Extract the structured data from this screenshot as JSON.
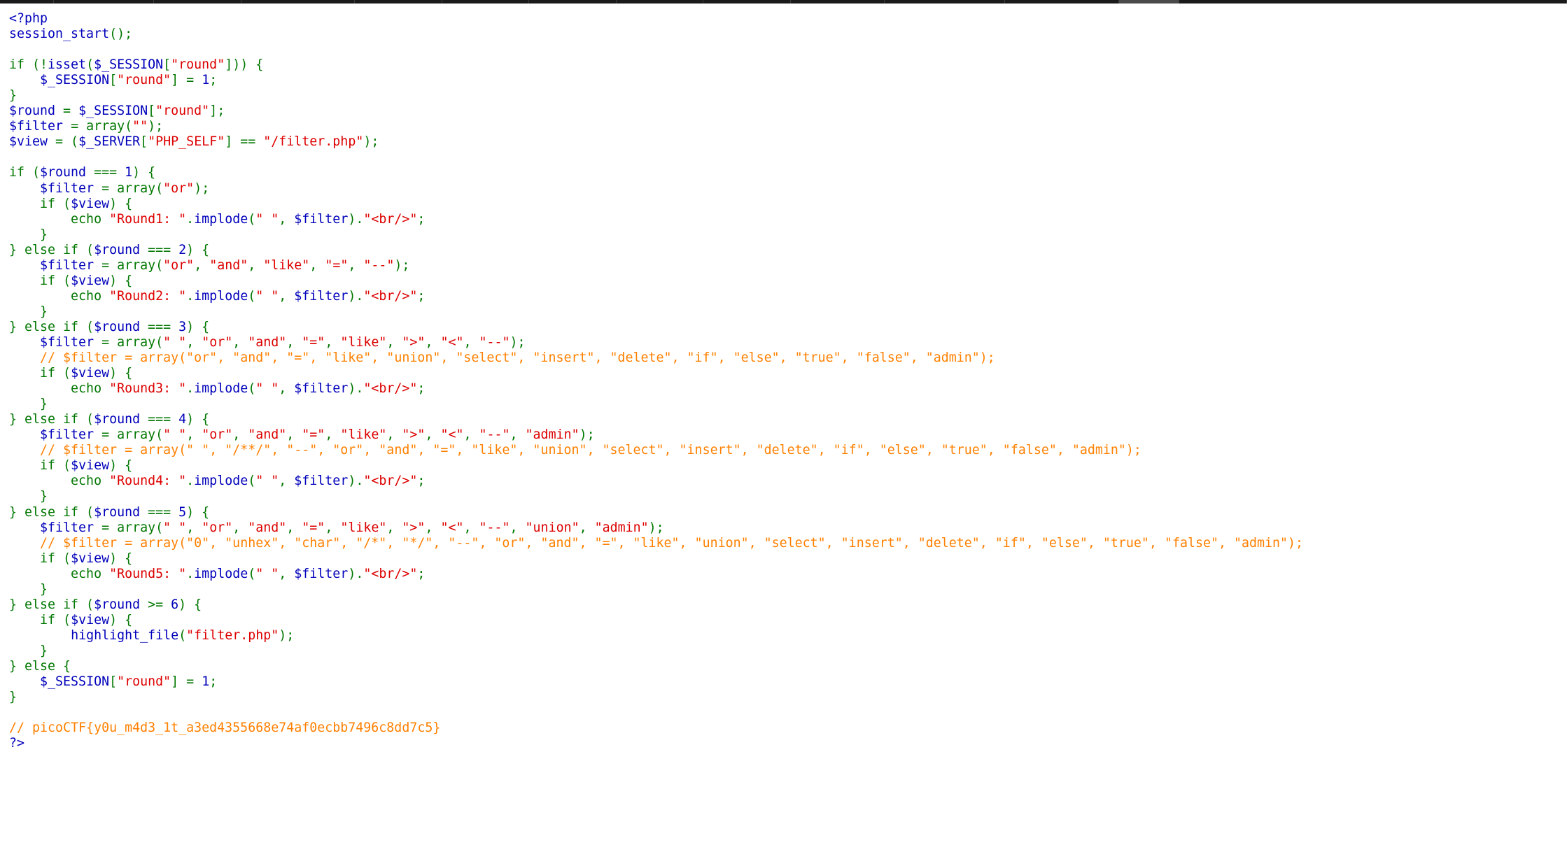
{
  "source": {
    "colors": {
      "default": "#0000BB",
      "keyword": "#007700",
      "string": "#DD0000",
      "comment": "#FF8000",
      "background": "#FFFFFF"
    },
    "lines": [
      [
        [
          "v",
          "<?php"
        ]
      ],
      [
        [
          "v",
          "session_start"
        ],
        [
          "k",
          "();"
        ]
      ],
      [],
      [
        [
          "k",
          "if (!"
        ],
        [
          "v",
          "isset"
        ],
        [
          "k",
          "("
        ],
        [
          "v",
          "$_SESSION"
        ],
        [
          "k",
          "["
        ],
        [
          "s",
          "\"round\""
        ],
        [
          "k",
          "])) {"
        ]
      ],
      [
        [
          "k",
          "    "
        ],
        [
          "v",
          "$_SESSION"
        ],
        [
          "k",
          "["
        ],
        [
          "s",
          "\"round\""
        ],
        [
          "k",
          "] = "
        ],
        [
          "v",
          "1"
        ],
        [
          "k",
          ";"
        ]
      ],
      [
        [
          "k",
          "}"
        ]
      ],
      [
        [
          "v",
          "$round "
        ],
        [
          "k",
          "= "
        ],
        [
          "v",
          "$_SESSION"
        ],
        [
          "k",
          "["
        ],
        [
          "s",
          "\"round\""
        ],
        [
          "k",
          "];"
        ]
      ],
      [
        [
          "v",
          "$filter "
        ],
        [
          "k",
          "= array("
        ],
        [
          "s",
          "\"\""
        ],
        [
          "k",
          ");"
        ]
      ],
      [
        [
          "v",
          "$view "
        ],
        [
          "k",
          "= ("
        ],
        [
          "v",
          "$_SERVER"
        ],
        [
          "k",
          "["
        ],
        [
          "s",
          "\"PHP_SELF\""
        ],
        [
          "k",
          "] == "
        ],
        [
          "s",
          "\"/filter.php\""
        ],
        [
          "k",
          ");"
        ]
      ],
      [],
      [
        [
          "k",
          "if ("
        ],
        [
          "v",
          "$round "
        ],
        [
          "k",
          "=== "
        ],
        [
          "v",
          "1"
        ],
        [
          "k",
          ") {"
        ]
      ],
      [
        [
          "k",
          "    "
        ],
        [
          "v",
          "$filter "
        ],
        [
          "k",
          "= array("
        ],
        [
          "s",
          "\"or\""
        ],
        [
          "k",
          ");"
        ]
      ],
      [
        [
          "k",
          "    if ("
        ],
        [
          "v",
          "$view"
        ],
        [
          "k",
          ") {"
        ]
      ],
      [
        [
          "k",
          "        echo "
        ],
        [
          "s",
          "\"Round1: \""
        ],
        [
          "k",
          "."
        ],
        [
          "v",
          "implode"
        ],
        [
          "k",
          "("
        ],
        [
          "s",
          "\" \""
        ],
        [
          "k",
          ", "
        ],
        [
          "v",
          "$filter"
        ],
        [
          "k",
          ")."
        ],
        [
          "s",
          "\"<br/>\""
        ],
        [
          "k",
          ";"
        ]
      ],
      [
        [
          "k",
          "    }"
        ]
      ],
      [
        [
          "k",
          "} else if ("
        ],
        [
          "v",
          "$round "
        ],
        [
          "k",
          "=== "
        ],
        [
          "v",
          "2"
        ],
        [
          "k",
          ") {"
        ]
      ],
      [
        [
          "k",
          "    "
        ],
        [
          "v",
          "$filter "
        ],
        [
          "k",
          "= array("
        ],
        [
          "s",
          "\"or\""
        ],
        [
          "k",
          ", "
        ],
        [
          "s",
          "\"and\""
        ],
        [
          "k",
          ", "
        ],
        [
          "s",
          "\"like\""
        ],
        [
          "k",
          ", "
        ],
        [
          "s",
          "\"=\""
        ],
        [
          "k",
          ", "
        ],
        [
          "s",
          "\"--\""
        ],
        [
          "k",
          ");"
        ]
      ],
      [
        [
          "k",
          "    if ("
        ],
        [
          "v",
          "$view"
        ],
        [
          "k",
          ") {"
        ]
      ],
      [
        [
          "k",
          "        echo "
        ],
        [
          "s",
          "\"Round2: \""
        ],
        [
          "k",
          "."
        ],
        [
          "v",
          "implode"
        ],
        [
          "k",
          "("
        ],
        [
          "s",
          "\" \""
        ],
        [
          "k",
          ", "
        ],
        [
          "v",
          "$filter"
        ],
        [
          "k",
          ")."
        ],
        [
          "s",
          "\"<br/>\""
        ],
        [
          "k",
          ";"
        ]
      ],
      [
        [
          "k",
          "    }"
        ]
      ],
      [
        [
          "k",
          "} else if ("
        ],
        [
          "v",
          "$round "
        ],
        [
          "k",
          "=== "
        ],
        [
          "v",
          "3"
        ],
        [
          "k",
          ") {"
        ]
      ],
      [
        [
          "k",
          "    "
        ],
        [
          "v",
          "$filter "
        ],
        [
          "k",
          "= array("
        ],
        [
          "s",
          "\" \""
        ],
        [
          "k",
          ", "
        ],
        [
          "s",
          "\"or\""
        ],
        [
          "k",
          ", "
        ],
        [
          "s",
          "\"and\""
        ],
        [
          "k",
          ", "
        ],
        [
          "s",
          "\"=\""
        ],
        [
          "k",
          ", "
        ],
        [
          "s",
          "\"like\""
        ],
        [
          "k",
          ", "
        ],
        [
          "s",
          "\">\""
        ],
        [
          "k",
          ", "
        ],
        [
          "s",
          "\"<\""
        ],
        [
          "k",
          ", "
        ],
        [
          "s",
          "\"--\""
        ],
        [
          "k",
          ");"
        ]
      ],
      [
        [
          "k",
          "    "
        ],
        [
          "c",
          "// $filter = array(\"or\", \"and\", \"=\", \"like\", \"union\", \"select\", \"insert\", \"delete\", \"if\", \"else\", \"true\", \"false\", \"admin\");"
        ]
      ],
      [
        [
          "k",
          "    if ("
        ],
        [
          "v",
          "$view"
        ],
        [
          "k",
          ") {"
        ]
      ],
      [
        [
          "k",
          "        echo "
        ],
        [
          "s",
          "\"Round3: \""
        ],
        [
          "k",
          "."
        ],
        [
          "v",
          "implode"
        ],
        [
          "k",
          "("
        ],
        [
          "s",
          "\" \""
        ],
        [
          "k",
          ", "
        ],
        [
          "v",
          "$filter"
        ],
        [
          "k",
          ")."
        ],
        [
          "s",
          "\"<br/>\""
        ],
        [
          "k",
          ";"
        ]
      ],
      [
        [
          "k",
          "    }"
        ]
      ],
      [
        [
          "k",
          "} else if ("
        ],
        [
          "v",
          "$round "
        ],
        [
          "k",
          "=== "
        ],
        [
          "v",
          "4"
        ],
        [
          "k",
          ") {"
        ]
      ],
      [
        [
          "k",
          "    "
        ],
        [
          "v",
          "$filter "
        ],
        [
          "k",
          "= array("
        ],
        [
          "s",
          "\" \""
        ],
        [
          "k",
          ", "
        ],
        [
          "s",
          "\"or\""
        ],
        [
          "k",
          ", "
        ],
        [
          "s",
          "\"and\""
        ],
        [
          "k",
          ", "
        ],
        [
          "s",
          "\"=\""
        ],
        [
          "k",
          ", "
        ],
        [
          "s",
          "\"like\""
        ],
        [
          "k",
          ", "
        ],
        [
          "s",
          "\">\""
        ],
        [
          "k",
          ", "
        ],
        [
          "s",
          "\"<\""
        ],
        [
          "k",
          ", "
        ],
        [
          "s",
          "\"--\""
        ],
        [
          "k",
          ", "
        ],
        [
          "s",
          "\"admin\""
        ],
        [
          "k",
          ");"
        ]
      ],
      [
        [
          "k",
          "    "
        ],
        [
          "c",
          "// $filter = array(\" \", \"/**/\", \"--\", \"or\", \"and\", \"=\", \"like\", \"union\", \"select\", \"insert\", \"delete\", \"if\", \"else\", \"true\", \"false\", \"admin\");"
        ]
      ],
      [
        [
          "k",
          "    if ("
        ],
        [
          "v",
          "$view"
        ],
        [
          "k",
          ") {"
        ]
      ],
      [
        [
          "k",
          "        echo "
        ],
        [
          "s",
          "\"Round4: \""
        ],
        [
          "k",
          "."
        ],
        [
          "v",
          "implode"
        ],
        [
          "k",
          "("
        ],
        [
          "s",
          "\" \""
        ],
        [
          "k",
          ", "
        ],
        [
          "v",
          "$filter"
        ],
        [
          "k",
          ")."
        ],
        [
          "s",
          "\"<br/>\""
        ],
        [
          "k",
          ";"
        ]
      ],
      [
        [
          "k",
          "    }"
        ]
      ],
      [
        [
          "k",
          "} else if ("
        ],
        [
          "v",
          "$round "
        ],
        [
          "k",
          "=== "
        ],
        [
          "v",
          "5"
        ],
        [
          "k",
          ") {"
        ]
      ],
      [
        [
          "k",
          "    "
        ],
        [
          "v",
          "$filter "
        ],
        [
          "k",
          "= array("
        ],
        [
          "s",
          "\" \""
        ],
        [
          "k",
          ", "
        ],
        [
          "s",
          "\"or\""
        ],
        [
          "k",
          ", "
        ],
        [
          "s",
          "\"and\""
        ],
        [
          "k",
          ", "
        ],
        [
          "s",
          "\"=\""
        ],
        [
          "k",
          ", "
        ],
        [
          "s",
          "\"like\""
        ],
        [
          "k",
          ", "
        ],
        [
          "s",
          "\">\""
        ],
        [
          "k",
          ", "
        ],
        [
          "s",
          "\"<\""
        ],
        [
          "k",
          ", "
        ],
        [
          "s",
          "\"--\""
        ],
        [
          "k",
          ", "
        ],
        [
          "s",
          "\"union\""
        ],
        [
          "k",
          ", "
        ],
        [
          "s",
          "\"admin\""
        ],
        [
          "k",
          ");"
        ]
      ],
      [
        [
          "k",
          "    "
        ],
        [
          "c",
          "// $filter = array(\"0\", \"unhex\", \"char\", \"/*\", \"*/\", \"--\", \"or\", \"and\", \"=\", \"like\", \"union\", \"select\", \"insert\", \"delete\", \"if\", \"else\", \"true\", \"false\", \"admin\");"
        ]
      ],
      [
        [
          "k",
          "    if ("
        ],
        [
          "v",
          "$view"
        ],
        [
          "k",
          ") {"
        ]
      ],
      [
        [
          "k",
          "        echo "
        ],
        [
          "s",
          "\"Round5: \""
        ],
        [
          "k",
          "."
        ],
        [
          "v",
          "implode"
        ],
        [
          "k",
          "("
        ],
        [
          "s",
          "\" \""
        ],
        [
          "k",
          ", "
        ],
        [
          "v",
          "$filter"
        ],
        [
          "k",
          ")."
        ],
        [
          "s",
          "\"<br/>\""
        ],
        [
          "k",
          ";"
        ]
      ],
      [
        [
          "k",
          "    }"
        ]
      ],
      [
        [
          "k",
          "} else if ("
        ],
        [
          "v",
          "$round "
        ],
        [
          "k",
          ">= "
        ],
        [
          "v",
          "6"
        ],
        [
          "k",
          ") {"
        ]
      ],
      [
        [
          "k",
          "    if ("
        ],
        [
          "v",
          "$view"
        ],
        [
          "k",
          ") {"
        ]
      ],
      [
        [
          "k",
          "        "
        ],
        [
          "v",
          "highlight_file"
        ],
        [
          "k",
          "("
        ],
        [
          "s",
          "\"filter.php\""
        ],
        [
          "k",
          ");"
        ]
      ],
      [
        [
          "k",
          "    }"
        ]
      ],
      [
        [
          "k",
          "} else {"
        ]
      ],
      [
        [
          "k",
          "    "
        ],
        [
          "v",
          "$_SESSION"
        ],
        [
          "k",
          "["
        ],
        [
          "s",
          "\"round\""
        ],
        [
          "k",
          "] = "
        ],
        [
          "v",
          "1"
        ],
        [
          "k",
          ";"
        ]
      ],
      [
        [
          "k",
          "}"
        ]
      ],
      [],
      [
        [
          "c",
          "// picoCTF{y0u_m4d3_1t_a3ed4355668e74af0ecbb7496c8dd7c5}"
        ]
      ],
      [
        [
          "v",
          "?>"
        ]
      ]
    ]
  }
}
